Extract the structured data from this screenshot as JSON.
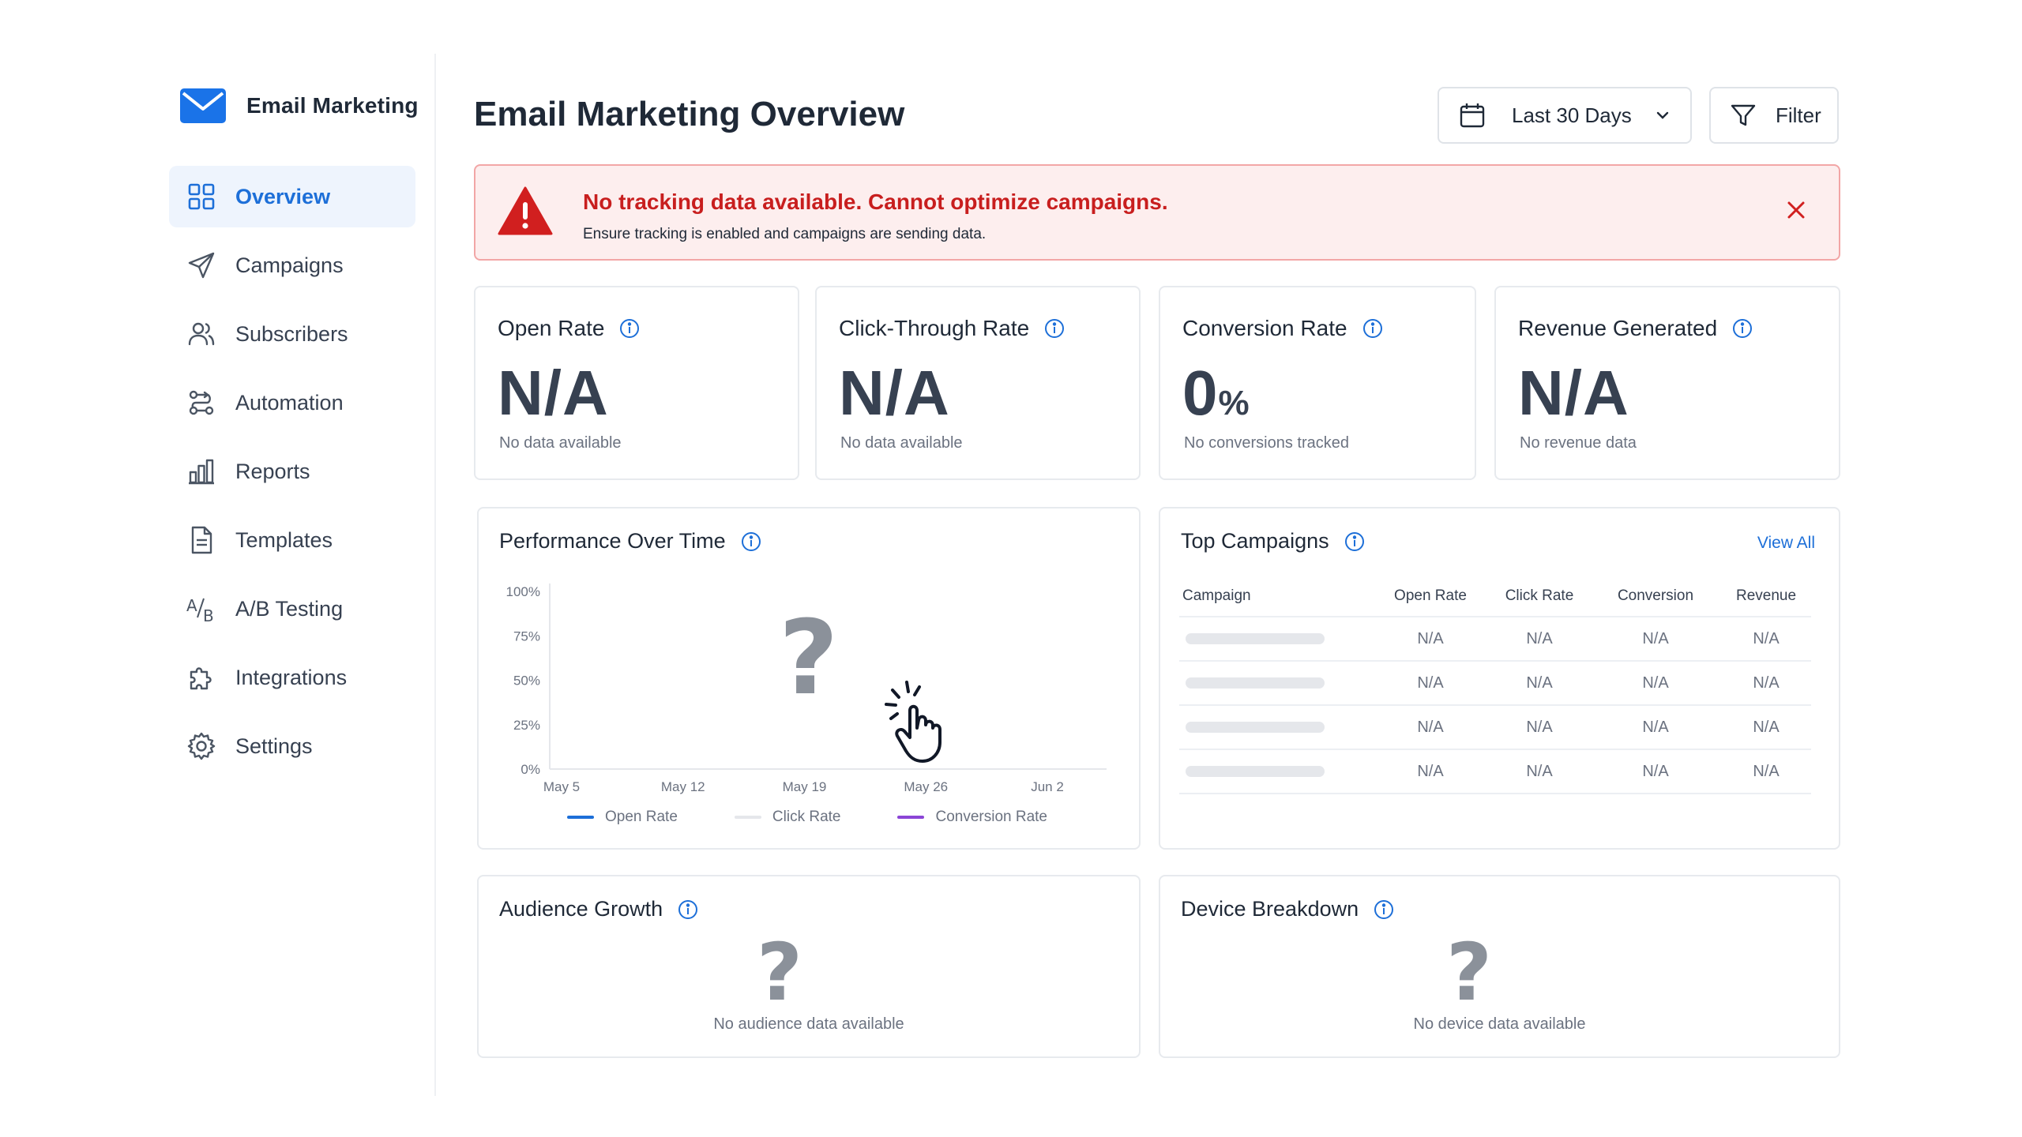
{
  "brand": {
    "name": "Email Marketing"
  },
  "sidebar": {
    "items": [
      {
        "label": "Overview",
        "icon": "grid-icon",
        "active": true
      },
      {
        "label": "Campaigns",
        "icon": "send-icon"
      },
      {
        "label": "Subscribers",
        "icon": "users-icon"
      },
      {
        "label": "Automation",
        "icon": "workflow-icon"
      },
      {
        "label": "Reports",
        "icon": "bar-chart-icon"
      },
      {
        "label": "Templates",
        "icon": "document-icon"
      },
      {
        "label": "A/B Testing",
        "icon": "ab-test-icon"
      },
      {
        "label": "Integrations",
        "icon": "puzzle-icon"
      },
      {
        "label": "Settings",
        "icon": "gear-icon"
      }
    ]
  },
  "header": {
    "title": "Email Marketing Overview",
    "date_range": "Last 30 Days",
    "filter_label": "Filter"
  },
  "alert": {
    "title": "No tracking data available. Cannot optimize campaigns.",
    "message": "Ensure tracking is enabled and campaigns are sending data."
  },
  "kpis": [
    {
      "title": "Open Rate",
      "value": "N/A",
      "unit": "",
      "sub": "No data available"
    },
    {
      "title": "Click-Through Rate",
      "value": "N/A",
      "unit": "",
      "sub": "No data available"
    },
    {
      "title": "Conversion Rate",
      "value": "0",
      "unit": "%",
      "sub": "No conversions tracked"
    },
    {
      "title": "Revenue Generated",
      "value": "N/A",
      "unit": "",
      "sub": "No revenue data"
    }
  ],
  "performance": {
    "title": "Performance Over Time",
    "placeholder": "?"
  },
  "chart_data": {
    "type": "line",
    "categories": [
      "May 5",
      "May 12",
      "May 19",
      "May 26",
      "Jun 2"
    ],
    "yticks": [
      "100%",
      "75%",
      "50%",
      "25%",
      "0%"
    ],
    "ylim": [
      0,
      100
    ],
    "series": [
      {
        "name": "Open Rate",
        "values": [],
        "color": "#1d6fd8"
      },
      {
        "name": "Click Rate",
        "values": [],
        "color": "#e5e7eb"
      },
      {
        "name": "Conversion Rate",
        "values": [],
        "color": "#8b45d6"
      }
    ],
    "grid": false,
    "legend": "bottom"
  },
  "top_campaigns": {
    "title": "Top Campaigns",
    "view_all": "View All",
    "columns": [
      "Campaign",
      "Open Rate",
      "Click Rate",
      "Conversion",
      "Revenue"
    ],
    "rows": [
      [
        "",
        "N/A",
        "N/A",
        "N/A",
        "N/A"
      ],
      [
        "",
        "N/A",
        "N/A",
        "N/A",
        "N/A"
      ],
      [
        "",
        "N/A",
        "N/A",
        "N/A",
        "N/A"
      ],
      [
        "",
        "N/A",
        "N/A",
        "N/A",
        "N/A"
      ]
    ]
  },
  "audience": {
    "title": "Audience Growth",
    "placeholder": "?",
    "empty": "No audience data available"
  },
  "devices": {
    "title": "Device Breakdown",
    "placeholder": "?",
    "empty": "No device data available"
  },
  "colors": {
    "accent": "#1d6fd8",
    "danger": "#c81e1e",
    "alert_bg": "#fdeeee"
  }
}
